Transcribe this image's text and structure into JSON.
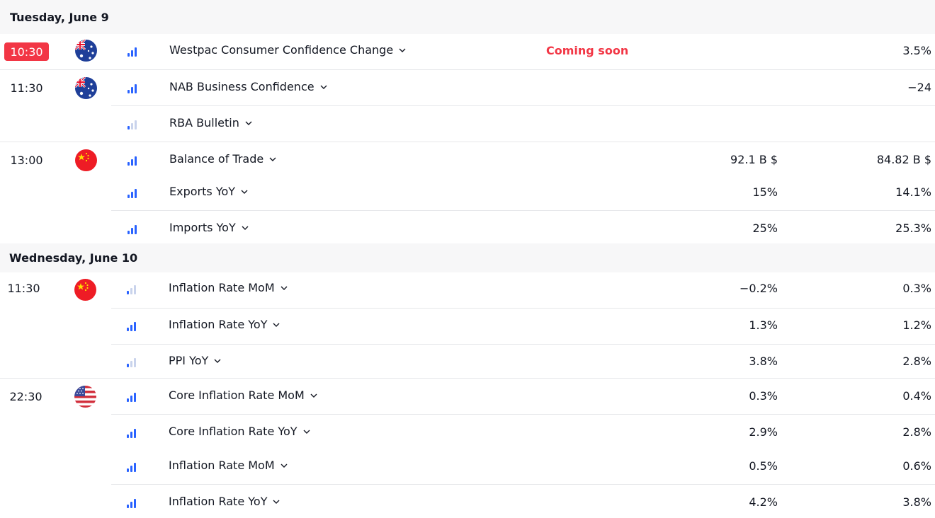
{
  "colors": {
    "accent_red": "#f23645",
    "bar_blue": "#2962ff",
    "bar_light": "#c9d3ec",
    "header_bg": "#f7f7f8"
  },
  "days": [
    {
      "label": "Tuesday, June 9",
      "events": [
        {
          "time": "10:30",
          "live": true,
          "flag": "australia-flag-icon",
          "importance": 3,
          "name": "Westpac Consumer Confidence Change",
          "status": "Coming soon",
          "actual": "",
          "previous": "3.5%"
        },
        {
          "time": "11:30",
          "live": false,
          "flag": "australia-flag-icon",
          "importance": 3,
          "name": "NAB Business Confidence",
          "status": "",
          "actual": "",
          "previous": "−24"
        },
        {
          "time": "",
          "live": false,
          "flag": "",
          "importance": 1,
          "name": "RBA Bulletin",
          "status": "",
          "actual": "",
          "previous": ""
        },
        {
          "time": "13:00",
          "live": false,
          "flag": "china-flag-icon",
          "importance": 3,
          "name": "Balance of Trade",
          "status": "",
          "actual": "92.1 B $",
          "previous": "84.82 B $"
        },
        {
          "time": "",
          "live": false,
          "flag": "",
          "importance": 3,
          "name": "Exports YoY",
          "status": "",
          "actual": "15%",
          "previous": "14.1%"
        },
        {
          "time": "",
          "live": false,
          "flag": "",
          "importance": 3,
          "name": "Imports YoY",
          "status": "",
          "actual": "25%",
          "previous": "25.3%"
        }
      ]
    },
    {
      "label": "Wednesday, June 10",
      "events": [
        {
          "time": "11:30",
          "live": false,
          "flag": "china-flag-icon",
          "importance": 1,
          "name": "Inflation Rate MoM",
          "status": "",
          "actual": "−0.2%",
          "previous": "0.3%"
        },
        {
          "time": "",
          "live": false,
          "flag": "",
          "importance": 3,
          "name": "Inflation Rate YoY",
          "status": "",
          "actual": "1.3%",
          "previous": "1.2%"
        },
        {
          "time": "",
          "live": false,
          "flag": "",
          "importance": 1,
          "name": "PPI YoY",
          "status": "",
          "actual": "3.8%",
          "previous": "2.8%"
        },
        {
          "time": "22:30",
          "live": false,
          "flag": "usa-flag-icon",
          "importance": 3,
          "name": "Core Inflation Rate MoM",
          "status": "",
          "actual": "0.3%",
          "previous": "0.4%"
        },
        {
          "time": "",
          "live": false,
          "flag": "",
          "importance": 3,
          "name": "Core Inflation Rate YoY",
          "status": "",
          "actual": "2.9%",
          "previous": "2.8%"
        },
        {
          "time": "",
          "live": false,
          "flag": "",
          "importance": 3,
          "name": "Inflation Rate MoM",
          "status": "",
          "actual": "0.5%",
          "previous": "0.6%"
        },
        {
          "time": "",
          "live": false,
          "flag": "",
          "importance": 3,
          "name": "Inflation Rate YoY",
          "status": "",
          "actual": "4.2%",
          "previous": "3.8%"
        }
      ]
    }
  ]
}
